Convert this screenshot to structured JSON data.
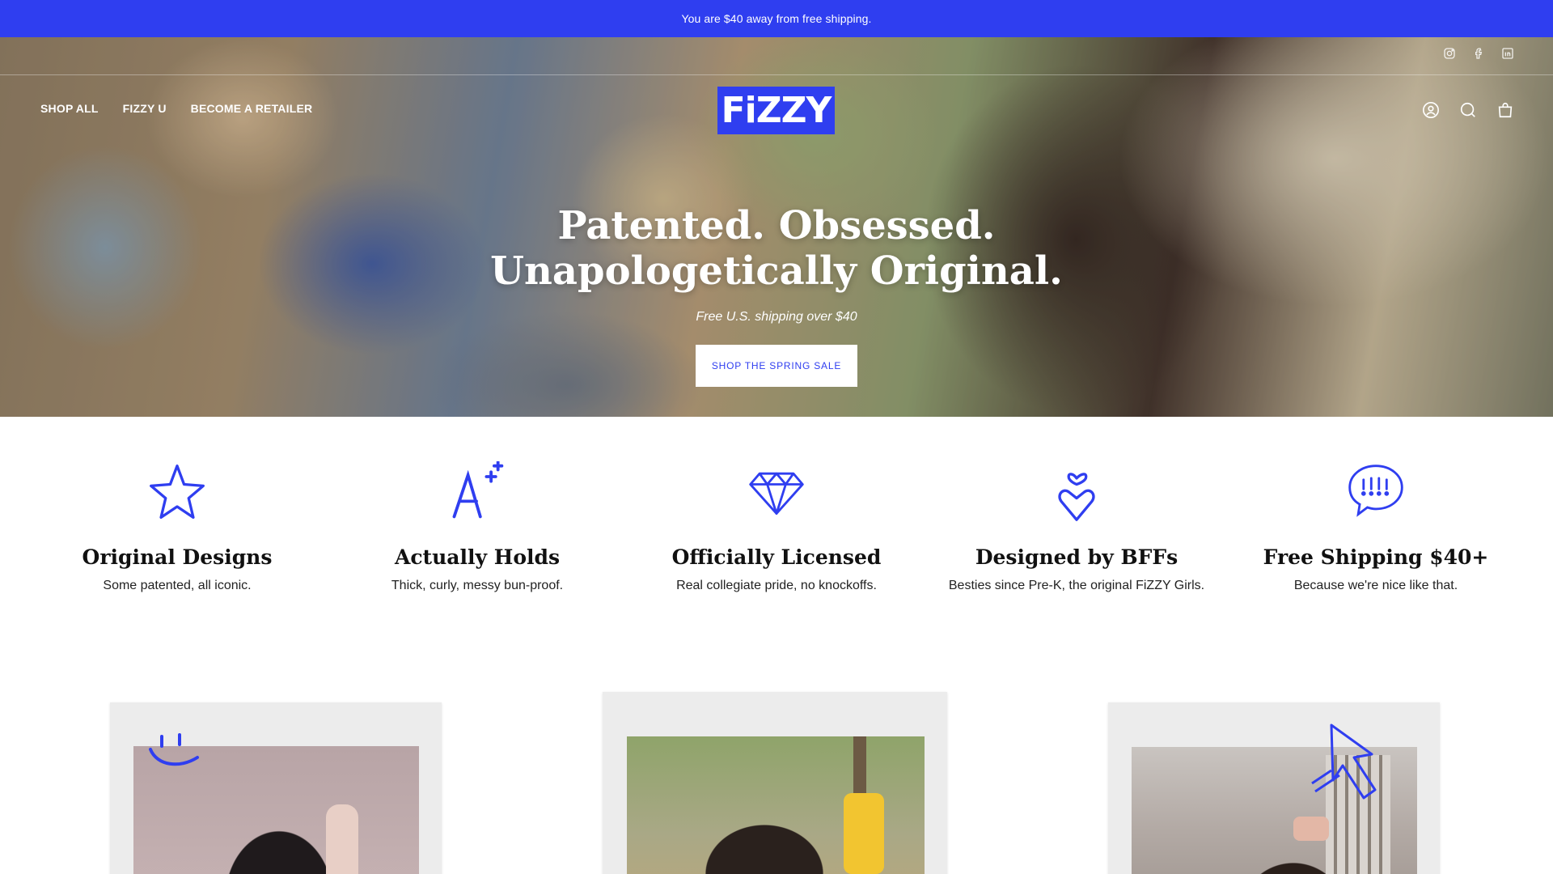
{
  "announcement": {
    "text": "You are $40 away from free shipping."
  },
  "header": {
    "nav": [
      {
        "label": "SHOP ALL"
      },
      {
        "label": "FIZZY U"
      },
      {
        "label": "BECOME A RETAILER"
      }
    ],
    "logo_text": "FiZZY",
    "social_icons": [
      "instagram-icon",
      "facebook-icon",
      "linkedin-icon"
    ],
    "utility_icons": [
      "account-icon",
      "search-icon",
      "cart-icon"
    ]
  },
  "hero": {
    "title": "Patented. Obsessed. Unapologetically Original.",
    "subtitle": "Free U.S. shipping over $40",
    "cta_label": "SHOP THE SPRING SALE"
  },
  "features": [
    {
      "icon": "star-icon",
      "title": "Original Designs",
      "text": "Some patented, all iconic."
    },
    {
      "icon": "a-plus-icon",
      "title": "Actually Holds",
      "text": "Thick, curly, messy bun-proof."
    },
    {
      "icon": "diamond-icon",
      "title": "Officially Licensed",
      "text": "Real collegiate pride, no knockoffs."
    },
    {
      "icon": "heart-icon",
      "title": "Designed by BFFs",
      "text": "Besties since Pre-K, the original FiZZY Girls."
    },
    {
      "icon": "speech-bubble-icon",
      "title": "Free Shipping $40+",
      "text": "Because we're nice like that."
    }
  ],
  "photos": [
    {
      "doodle": "smiley-doodle-icon"
    },
    {
      "doodle": ""
    },
    {
      "doodle": "arrow-doodle-icon"
    }
  ],
  "colors": {
    "brand_blue": "#2f3ef0",
    "white": "#ffffff",
    "text": "#111111"
  }
}
